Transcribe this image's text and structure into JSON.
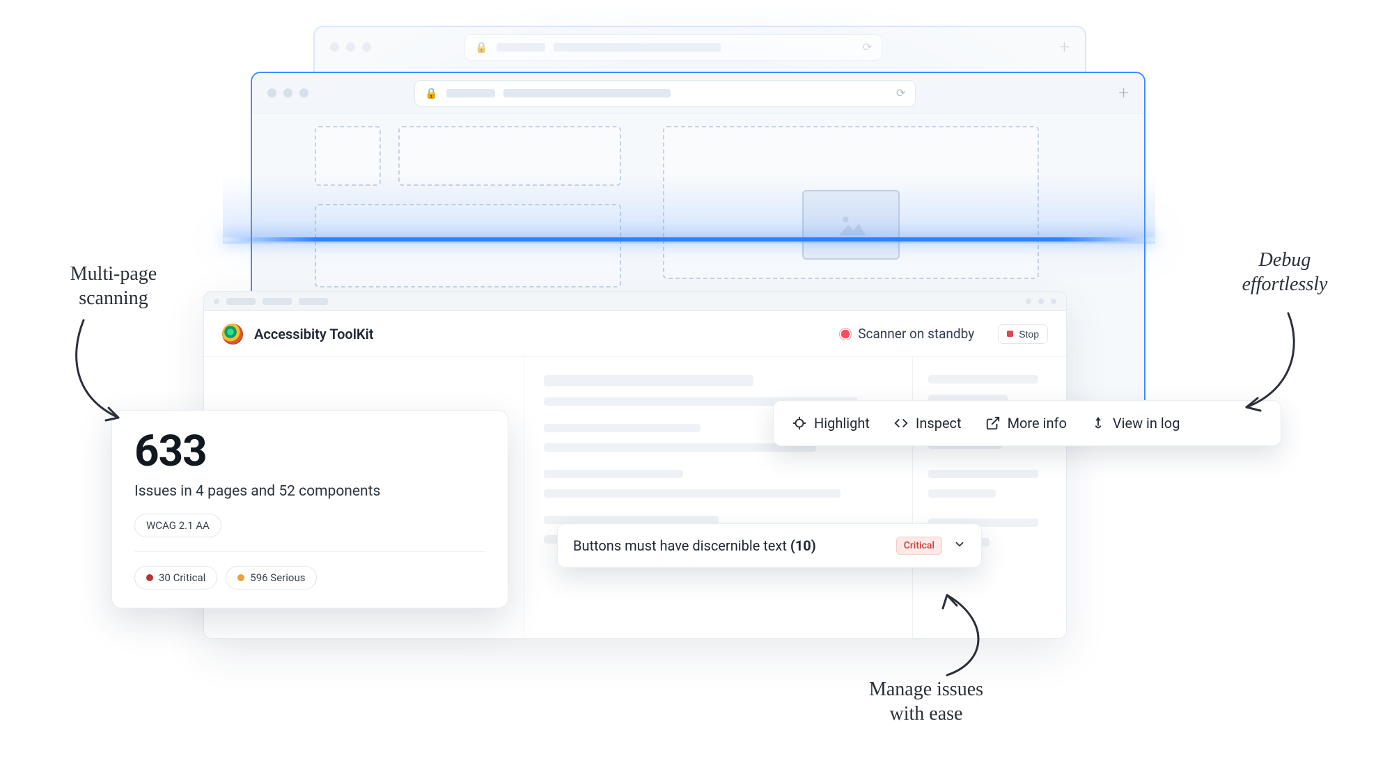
{
  "browser": {
    "plus_glyph": "+",
    "lock_glyph": "🔒",
    "refresh_glyph": "⟳"
  },
  "toolkit": {
    "title": "Accessibity ToolKit",
    "status_text": "Scanner on standby",
    "stop_label": "Stop"
  },
  "stats": {
    "count": "633",
    "subtitle": "Issues in 4 pages and 52 components",
    "standard": "WCAG 2.1 AA",
    "critical_label": "30 Critical",
    "serious_label": "596 Serious"
  },
  "issue": {
    "text": "Buttons must have discernible text",
    "count": "(10)",
    "severity": "Critical"
  },
  "actions": {
    "highlight": "Highlight",
    "inspect": "Inspect",
    "more_info": "More info",
    "view_in_log": "View in log"
  },
  "annotations": {
    "multi_page": "Multi-page\nscanning",
    "debug": "Debug\neffortlessly",
    "manage": "Manage issues\nwith ease"
  }
}
